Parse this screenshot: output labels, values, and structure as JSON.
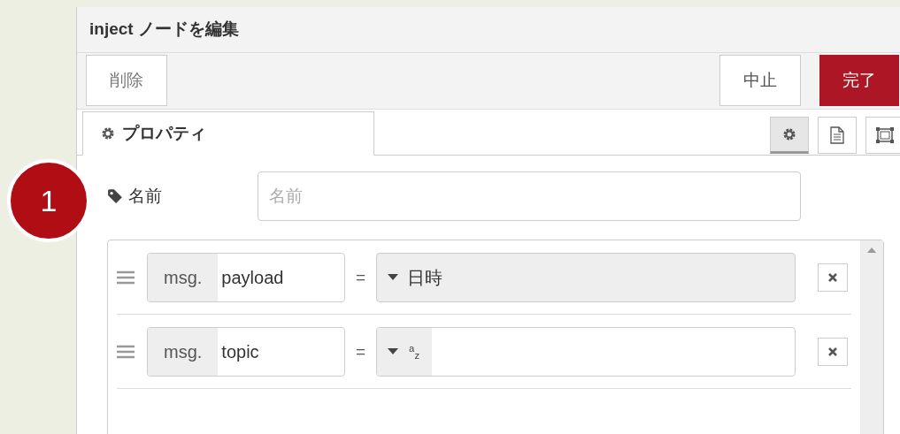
{
  "badge": "1",
  "panel": {
    "title": "inject ノードを編集"
  },
  "buttons": {
    "delete": "削除",
    "cancel": "中止",
    "done": "完了"
  },
  "tabs": [
    {
      "label": "プロパティ",
      "selected": true
    }
  ],
  "side_tabs": [
    {
      "kind": "settings",
      "selected": true
    },
    {
      "kind": "description",
      "selected": false
    },
    {
      "kind": "appearance",
      "selected": false
    }
  ],
  "name_field": {
    "label": "名前",
    "placeholder": "名前"
  },
  "properties": [
    {
      "prefix": "msg.",
      "property": "payload",
      "equals": "=",
      "kind": "select",
      "type_label": "日時"
    },
    {
      "prefix": "msg.",
      "property": "topic",
      "equals": "=",
      "kind": "string",
      "type_label": "$^{a}$$_{z}$"
    }
  ]
}
